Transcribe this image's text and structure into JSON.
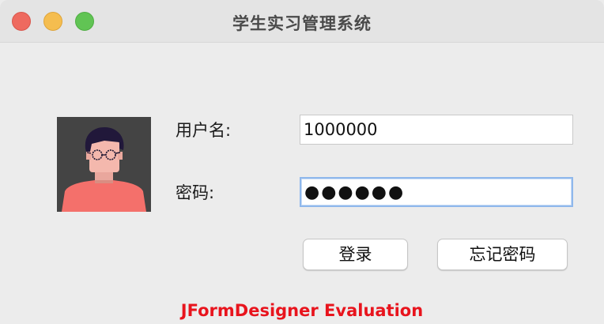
{
  "window": {
    "title": "学生实习管理系统"
  },
  "form": {
    "username_label": "用户名:",
    "username_value": "1000000",
    "password_label": "密码:",
    "password_value": "●●●●●●"
  },
  "buttons": {
    "login": "登录",
    "forgot": "忘记密码"
  },
  "watermark": "JFormDesigner Evaluation",
  "colors": {
    "watermark": "#e8141d",
    "focus_ring": "#8fb8ec",
    "avatar_bg": "#444444",
    "shirt": "#f4706b"
  }
}
